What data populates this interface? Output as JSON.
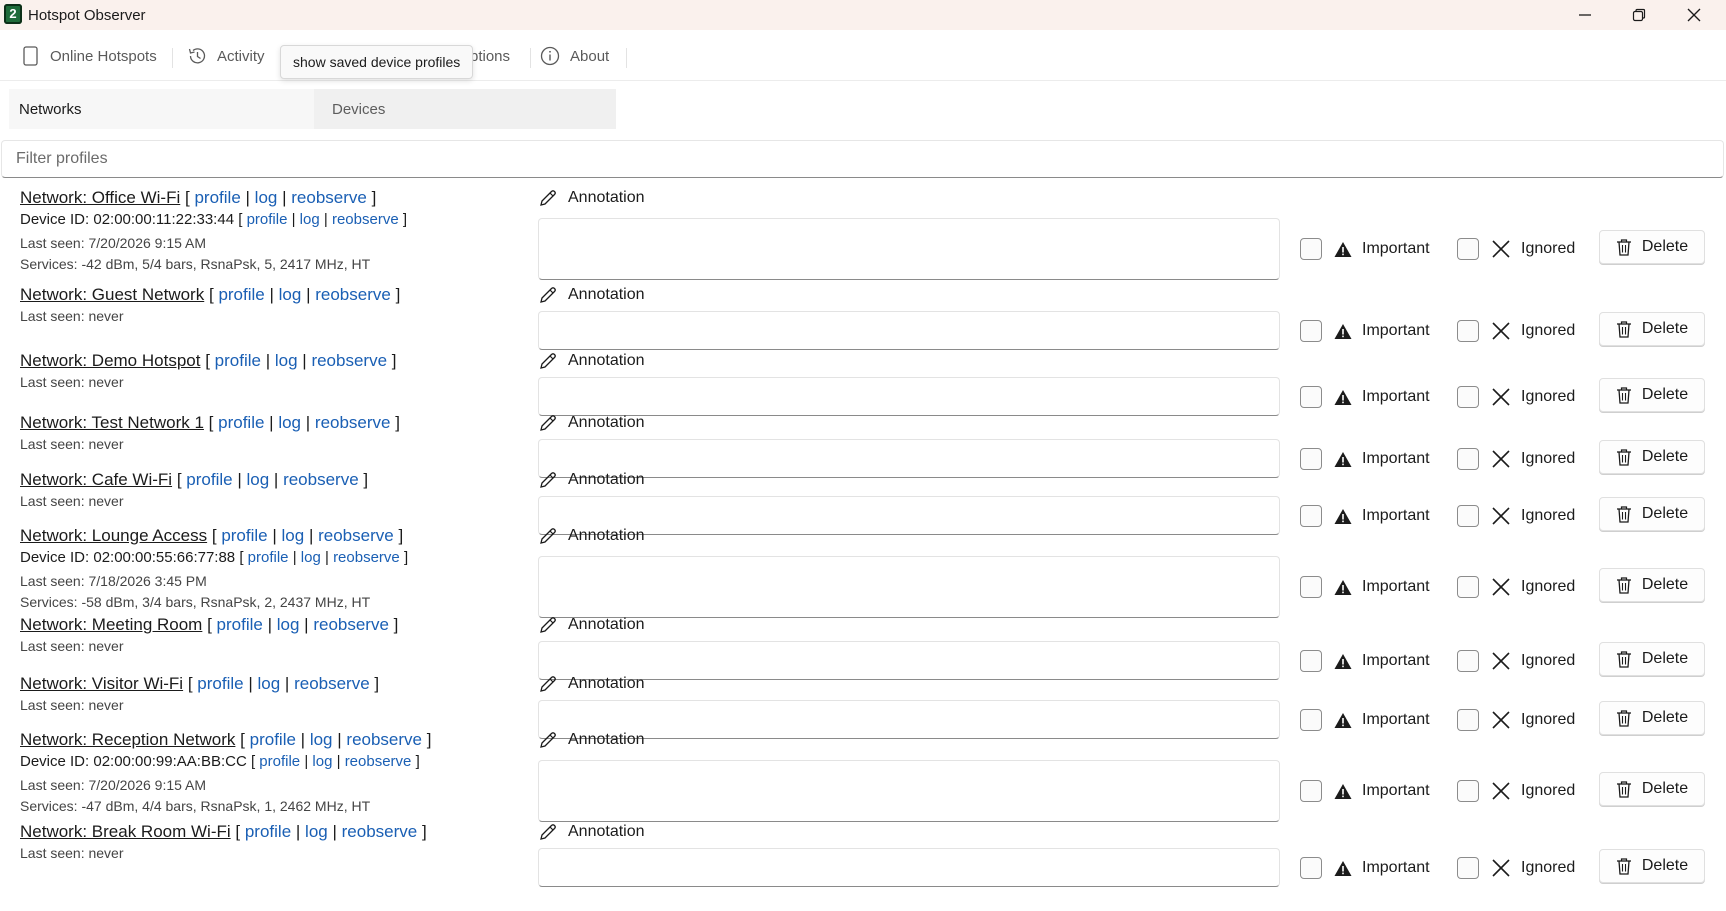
{
  "window": {
    "title": "Hotspot Observer",
    "logo_text": "2"
  },
  "menu": {
    "online_hotspots": "Online Hotspots",
    "activity": "Activity",
    "options_partial": "ptions",
    "about": "About"
  },
  "tooltip": "show saved device profiles",
  "tabs": {
    "networks": "Networks",
    "devices": "Devices"
  },
  "filter": {
    "placeholder": "Filter profiles",
    "value": ""
  },
  "labels": {
    "annotation": "Annotation",
    "important": "Important",
    "ignored": "Ignored",
    "delete": "Delete",
    "profile": "profile",
    "log": "log",
    "reobserve": "reobserve",
    "bracket_open": "[",
    "bracket_close": "]",
    "pipe": "|"
  },
  "profiles": [
    {
      "network": "Network: Office Wi-Fi",
      "device_id": "Device ID: 02:00:00:11:22:33:44",
      "last_seen": "Last seen: 7/20/2026 9:15 AM",
      "services": "Services: -42 dBm, 5/4 bars, RsnaPsk, 5, 2417 MHz, HT"
    },
    {
      "network": "Network: Guest Network",
      "last_seen": "Last seen: never"
    },
    {
      "network": "Network: Demo Hotspot",
      "last_seen": "Last seen: never"
    },
    {
      "network": "Network: Test Network 1",
      "last_seen": "Last seen: never"
    },
    {
      "network": "Network: Cafe Wi-Fi",
      "last_seen": "Last seen: never"
    },
    {
      "network": "Network: Lounge Access",
      "device_id": "Device ID: 02:00:00:55:66:77:88",
      "last_seen": "Last seen: 7/18/2026 3:45 PM",
      "services": "Services: -58 dBm, 3/4 bars, RsnaPsk, 2, 2437 MHz, HT"
    },
    {
      "network": "Network: Meeting Room",
      "last_seen": "Last seen: never"
    },
    {
      "network": "Network: Visitor Wi-Fi",
      "last_seen": "Last seen: never"
    },
    {
      "network": "Network: Reception Network",
      "device_id": "Device ID: 02:00:00:99:AA:BB:CC",
      "last_seen": "Last seen: 7/20/2026 9:15 AM",
      "services": "Services: -47 dBm, 4/4 bars, RsnaPsk, 1, 2462 MHz, HT"
    },
    {
      "network": "Network: Break Room Wi-Fi",
      "last_seen": "Last seen: never"
    }
  ]
}
